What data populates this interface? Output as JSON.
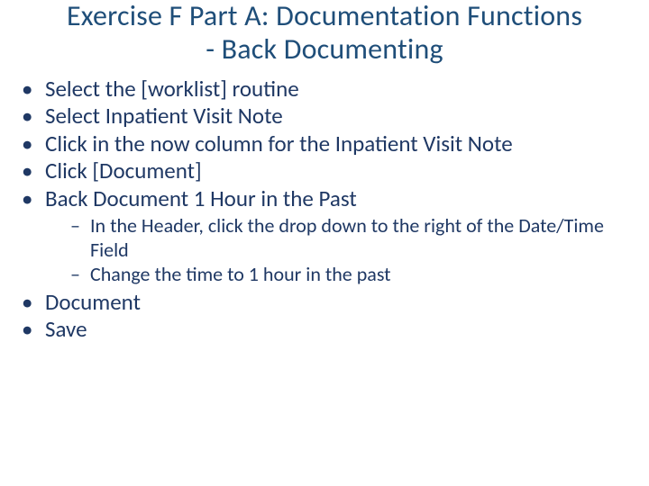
{
  "title_line1": "Exercise F Part A: Documentation Functions",
  "title_line2": "- Back Documenting",
  "bullets": {
    "b1": "Select the [worklist] routine",
    "b2": "Select Inpatient Visit Note",
    "b3": "Click in the now column for the Inpatient Visit Note",
    "b4": "Click [Document]",
    "b5": "Back Document 1 Hour in the Past",
    "b5_sub1": "In the Header, click the drop down to the right of the Date/Time Field",
    "b5_sub2": "Change the time to 1 hour in the past",
    "b6": "Document",
    "b7": "Save"
  }
}
